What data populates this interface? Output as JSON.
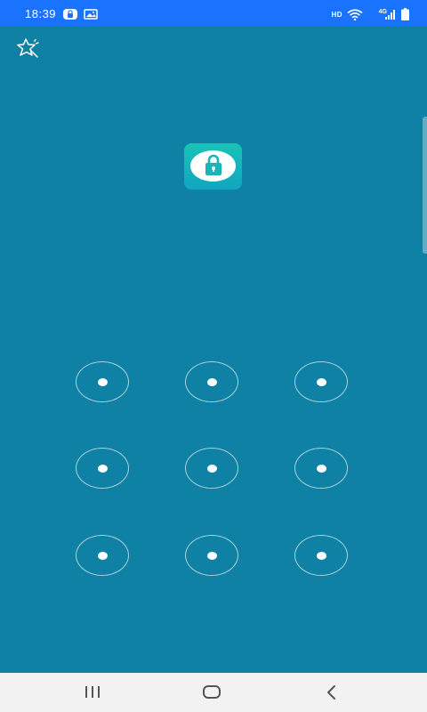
{
  "status_bar": {
    "time": "18:39",
    "hd": "HD",
    "network": "4G",
    "icons": [
      "lock-notification-icon",
      "image-notification-icon",
      "wifi-icon",
      "signal-icon",
      "battery-icon"
    ]
  },
  "colors": {
    "background": "#0f81a4",
    "status_bar": "#1a73ff",
    "app_icon_top": "#19c3b4",
    "app_icon_bottom": "#11a6c0",
    "nav_bar": "#f2f2f2"
  },
  "top_bar": {
    "icon": "sparkle-star-icon"
  },
  "app": {
    "icon": "padlock-app-icon"
  },
  "pattern": {
    "rows": 3,
    "columns": 3,
    "selected": []
  },
  "nav_bar": {
    "buttons": [
      "recent-apps-icon",
      "home-icon",
      "back-icon"
    ]
  }
}
